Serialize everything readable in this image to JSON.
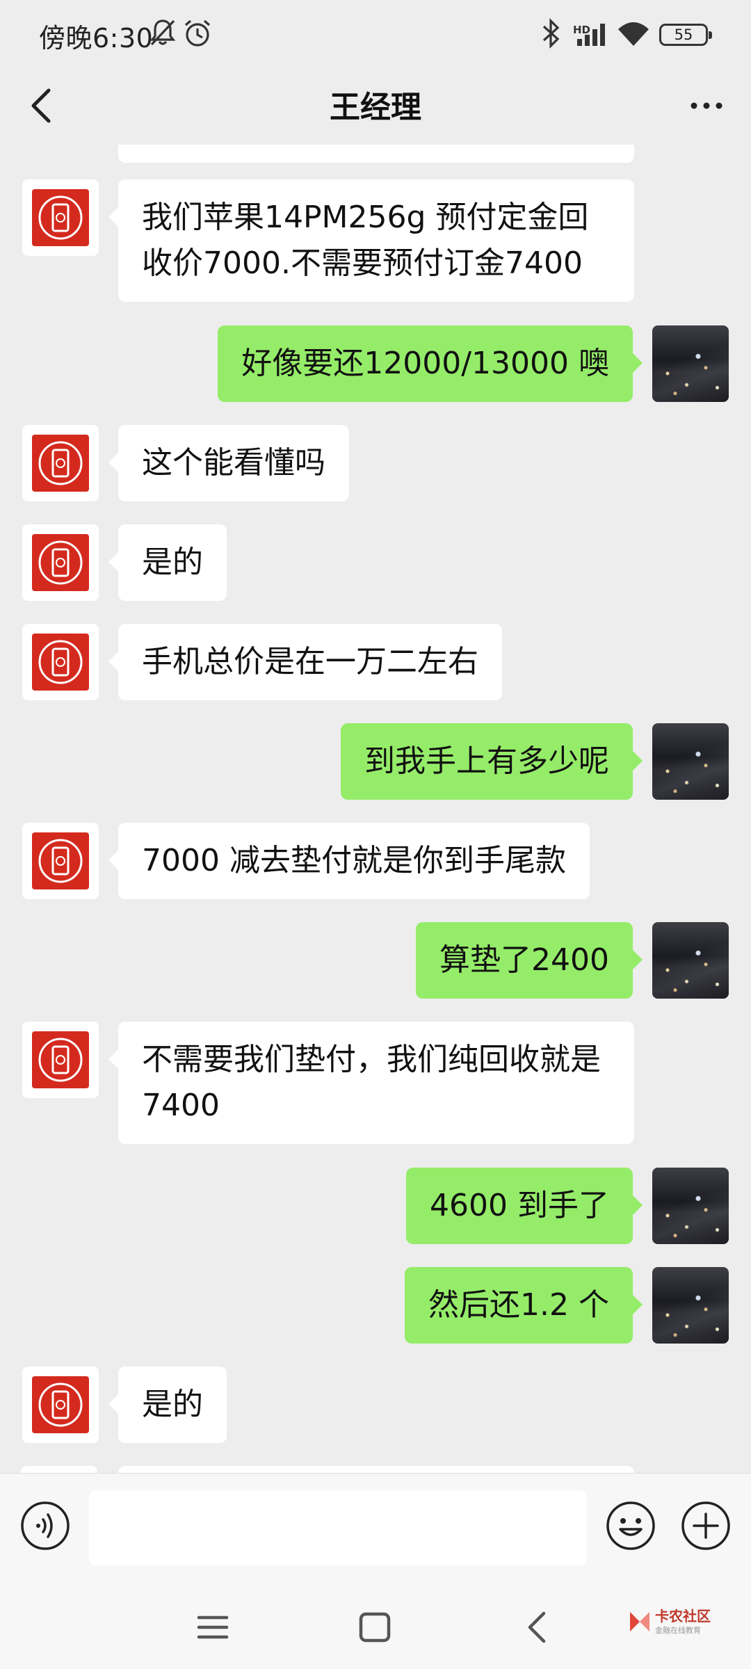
{
  "status_bar": {
    "time": "傍晚6:30",
    "network_label": "HD",
    "battery": "55",
    "icons": [
      "bell-off-icon",
      "alarm-icon",
      "bluetooth-icon",
      "signal-icon",
      "wifi-icon",
      "battery-icon"
    ]
  },
  "header": {
    "title": "王经理",
    "back_icon": "chevron-left-icon",
    "more_icon": "more-dots-icon"
  },
  "messages": [
    {
      "side": "left",
      "text": "我们苹果14PM256g 预付定金回收价7000.不需要预付订金7400"
    },
    {
      "side": "right",
      "text": "好像要还12000/13000 噢"
    },
    {
      "side": "left",
      "text": "这个能看懂吗"
    },
    {
      "side": "left",
      "text": "是的"
    },
    {
      "side": "left",
      "text": "手机总价是在一万二左右"
    },
    {
      "side": "right",
      "text": "到我手上有多少呢"
    },
    {
      "side": "left",
      "text": "7000 减去垫付就是你到手尾款"
    },
    {
      "side": "right",
      "text": "算垫了2400"
    },
    {
      "side": "left",
      "text": "不需要我们垫付，我们纯回收就是7400"
    },
    {
      "side": "right",
      "text": "4600 到手了"
    },
    {
      "side": "right",
      "text": "然后还1.2 个"
    },
    {
      "side": "left",
      "text": "是的"
    }
  ],
  "input_bar": {
    "value": "",
    "icons": [
      "voice-icon",
      "emoji-icon",
      "plus-icon"
    ]
  },
  "system_nav": {
    "icons": [
      "menu-icon",
      "home-icon",
      "back-icon"
    ]
  },
  "watermark": {
    "name": "卡农社区",
    "tagline": "金融在线教育"
  },
  "colors": {
    "background": "#ededed",
    "bubble_self": "#95ec69",
    "bubble_other": "#ffffff",
    "avatar_logo": "#d42a1e"
  }
}
